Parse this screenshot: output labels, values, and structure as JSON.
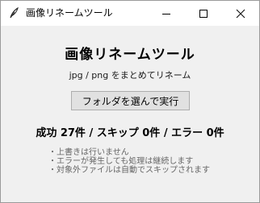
{
  "window": {
    "title": "画像リネームツール",
    "icon": "feather-icon"
  },
  "controls": {
    "minimize_icon": "minimize-icon",
    "maximize_icon": "maximize-icon",
    "close_icon": "close-icon"
  },
  "main": {
    "title": "画像リネームツール",
    "subtitle": "jpg / png をまとめてリネーム",
    "select_button_label": "フォルダを選んで実行",
    "result": "成功 27件 / スキップ 0件 / エラー 0件",
    "notes": [
      "・上書きは行いません",
      "・エラーが発生しても処理は継続します",
      "・対象外ファイルは自動でスキップされます"
    ]
  }
}
